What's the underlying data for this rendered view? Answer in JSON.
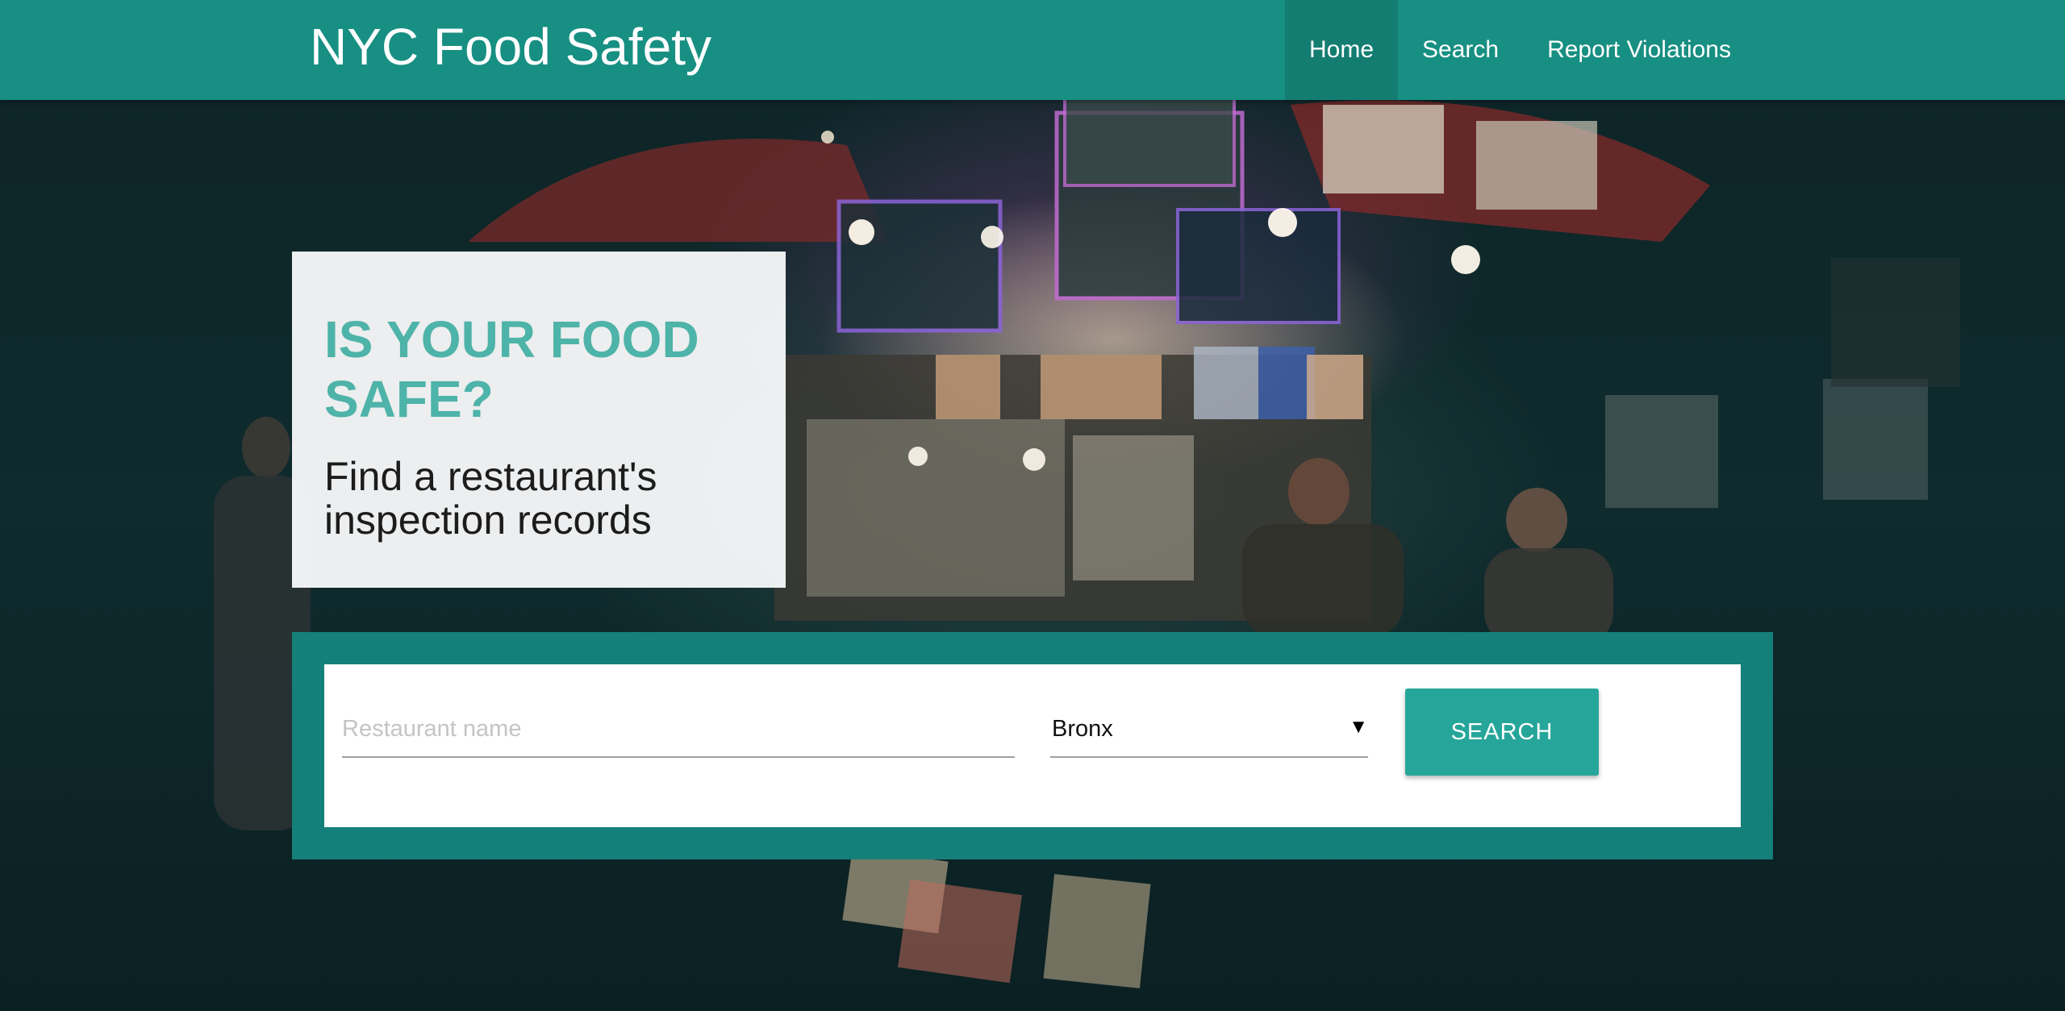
{
  "colors": {
    "navbar": "#178f82",
    "accent": "#26a69a",
    "headline": "#4eb3a8",
    "search_frame": "#15807a"
  },
  "navbar": {
    "brand": "NYC Food Safety",
    "links": [
      {
        "label": "Home",
        "active": true
      },
      {
        "label": "Search",
        "active": false
      },
      {
        "label": "Report Violations",
        "active": false
      }
    ]
  },
  "hero": {
    "headline": "IS YOUR FOOD SAFE?",
    "subheadline": "Find a restaurant's inspection records",
    "background_icon": "street-food-cart-night-photo"
  },
  "search": {
    "name_placeholder": "Restaurant name",
    "name_value": "",
    "borough_selected": "Bronx",
    "caret_icon": "triangle-down-icon",
    "button_label": "SEARCH"
  }
}
